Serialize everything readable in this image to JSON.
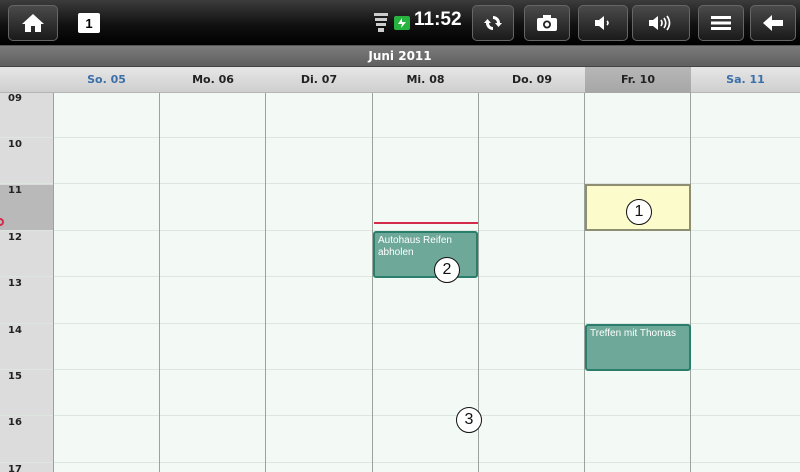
{
  "status_bar": {
    "home_icon": "home-icon",
    "notification_badge": "1",
    "time": "11:52"
  },
  "month_title": "Juni 2011",
  "days": [
    {
      "label": "So. 05",
      "weekend": true
    },
    {
      "label": "Mo. 06"
    },
    {
      "label": "Di. 07"
    },
    {
      "label": "Mi. 08"
    },
    {
      "label": "Do. 09"
    },
    {
      "label": "Fr. 10",
      "today": true
    },
    {
      "label": "Sa. 11",
      "weekend": true
    }
  ],
  "hours": [
    "09",
    "10",
    "11",
    "12",
    "13",
    "14",
    "15",
    "16",
    "17"
  ],
  "events": [
    {
      "title": "Autohaus Reifen abholen",
      "day": "Mi. 08"
    },
    {
      "title": "Treffen mit Thomas",
      "day": "Fr. 10"
    }
  ],
  "callouts": [
    "1",
    "2",
    "3"
  ],
  "colors": {
    "event_fill": "#6ea899",
    "event_border": "#2b7d6c",
    "selected_slot": "#fbfbcb",
    "now_line": "#d52b4b",
    "weekend_text": "#3b6fa8"
  }
}
